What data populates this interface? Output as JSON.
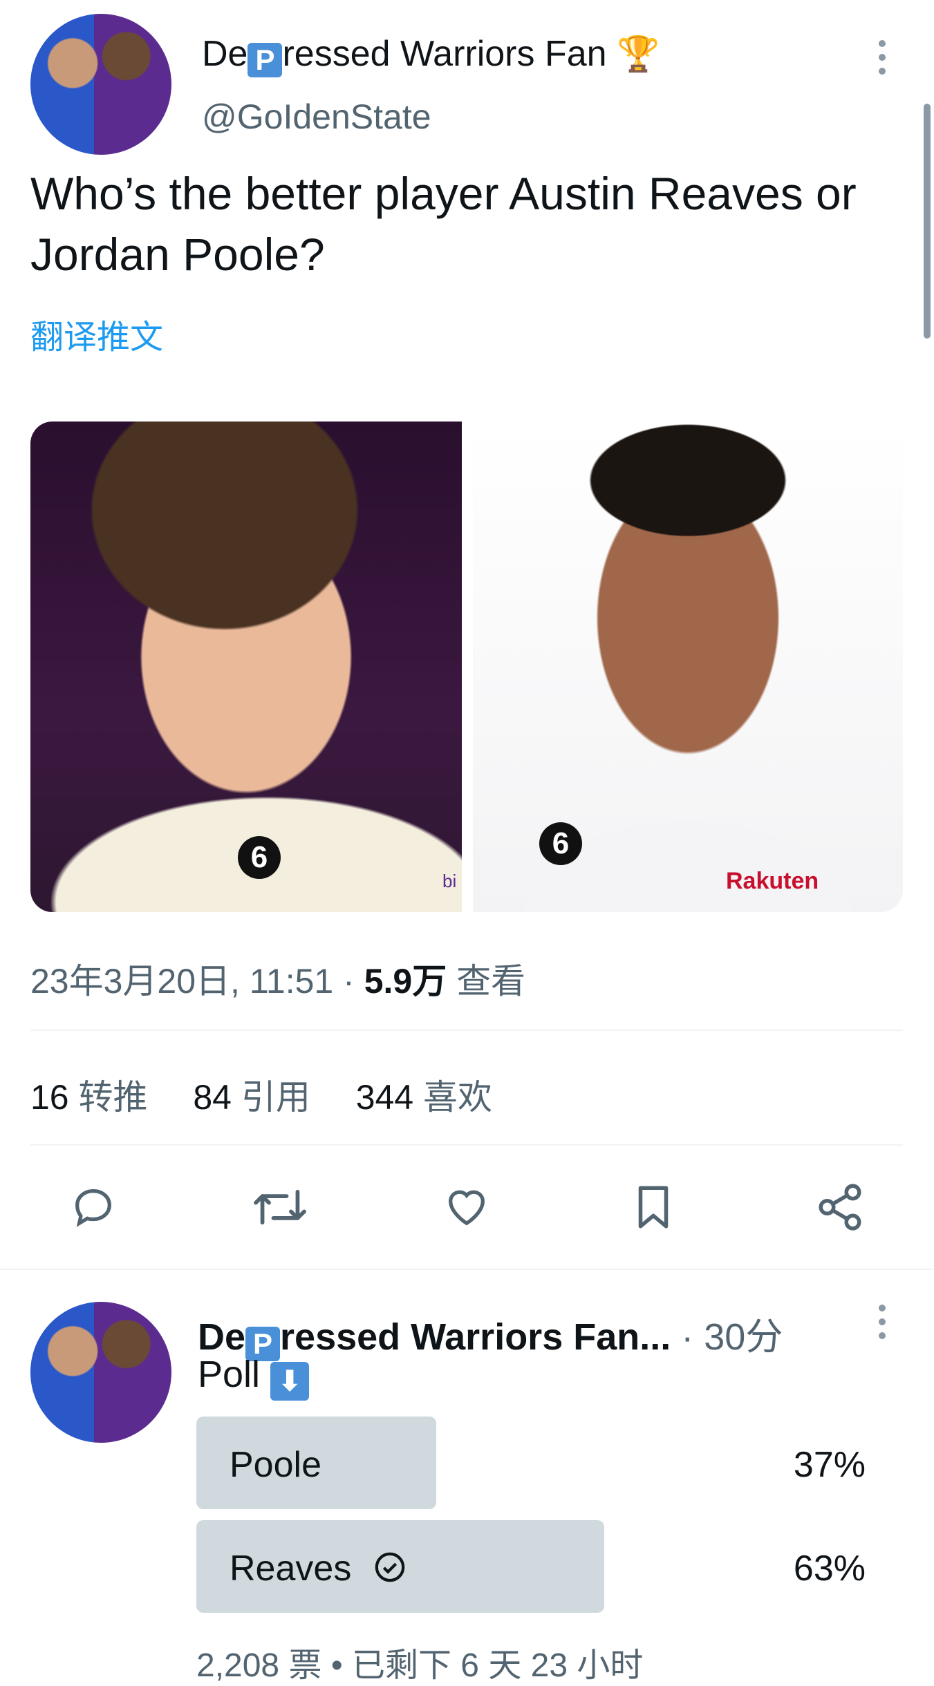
{
  "tweet": {
    "author_prefix": "De",
    "author_emoji": "P",
    "author_suffix": "ressed Warriors Fan",
    "author_trophy": "🏆",
    "handle": "@GoIdenState",
    "text": "Who’s the better player Austin Reaves or Jordan Poole?",
    "translate_label": "翻译推文",
    "timestamp": "23年3月20日, 11:51",
    "separator": "·",
    "views_count": "5.9万",
    "views_label": "查看",
    "media": [
      {
        "jersey_number": "6",
        "sponsor": "bi"
      },
      {
        "jersey_number": "6",
        "sponsor": "Rakuten"
      }
    ]
  },
  "stats": {
    "retweets_count": "16",
    "retweets_label": "转推",
    "quotes_count": "84",
    "quotes_label": "引用",
    "likes_count": "344",
    "likes_label": "喜欢"
  },
  "actions": [
    "reply-icon",
    "retweet-icon",
    "like-icon",
    "bookmark-icon",
    "share-icon"
  ],
  "reply": {
    "author_prefix": "De",
    "author_emoji": "P",
    "author_suffix": "ressed Warriors Fan...",
    "separator": "·",
    "time": "30分",
    "text": "Poll",
    "text_emoji": "⬇",
    "poll": {
      "options": [
        {
          "label": "Poole",
          "percent": "37%",
          "fraction": 0.37,
          "selected": false
        },
        {
          "label": "Reaves",
          "percent": "63%",
          "fraction": 0.63,
          "selected": true
        }
      ],
      "votes": "2,208 票",
      "bullet": "•",
      "remaining": "已剩下 6 天 23 小时"
    }
  },
  "colors": {
    "link": "#1d9bf0",
    "secondary_text": "#536471",
    "poll_bar": "#cfd9de"
  }
}
